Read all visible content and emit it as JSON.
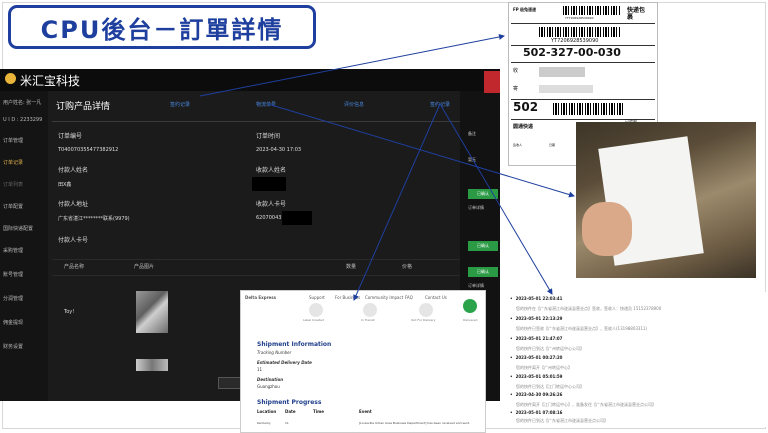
{
  "slide_title": "CPU後台－訂單詳情",
  "app": {
    "name": "米汇宝科技",
    "sidebar": [
      "用户姓名:   张一凡",
      "U I D :   2233299",
      "订单管理",
      "订单记录",
      "订单列表",
      "订单配置",
      "国际快递配置",
      "采购管理",
      "账号管理",
      "分润管理",
      "佣金提现",
      "财务设置"
    ],
    "section_title": "订购产品详情",
    "tabs": [
      "签约记录",
      "物流单号",
      "评价信息",
      "签约记录"
    ],
    "fields": {
      "order_no_label": "订单编号",
      "order_no": "T040070355477382912",
      "order_time_label": "订单时间",
      "order_time": "2023-04-30 17:03",
      "payer_name_label": "付款人姓名",
      "payer_name": "田X鑫",
      "receiver_name_label": "收款人姓名",
      "payer_address_label": "付款人地址",
      "payer_address": "广东省湛江********联系(9979)",
      "receiver_card_label": "收款人卡号",
      "receiver_card": "62070043",
      "payer_card_label": "付款人卡号"
    },
    "table_headers": [
      "产品名称",
      "产品图片",
      "数量",
      "价格"
    ],
    "product_name": "Toy!",
    "right_col": [
      "备注",
      "暂无",
      "已确认",
      "订单详情",
      "已确认",
      "已确认",
      "订单详情",
      "订单详情"
    ]
  },
  "shipping_label": {
    "brand": "FP 极兔速递",
    "tracking_top": "YT7206928539090",
    "service": "快递包裹",
    "tracking_mid": "YT7206928539090",
    "route_code": "502-327-00-030",
    "sender_prefix": "收",
    "receiver_prefix": "寄",
    "zip": "502",
    "footer_label": "圆通快递",
    "sign": "签收人",
    "date_label": "日期",
    "footer_note": "已验视"
  },
  "tracking_site": {
    "nav": [
      "Delta Express",
      "Support",
      "For Business",
      "Community Impact",
      "FAQ",
      "Contact Us"
    ],
    "steps": [
      "Label Created",
      "In Transit",
      "Out For Delivery",
      "Delivered"
    ],
    "shipment_info_title": "Shipment Information",
    "tracking_number_label": "Tracking Number",
    "delivery_date_label": "Estimated Delivery Date",
    "delivery_date": "11",
    "destination_label": "Destination",
    "destination": "Guangzhou",
    "progress_title": "Shipment Progress",
    "columns": [
      "Location",
      "Date",
      "Time",
      "Event"
    ],
    "row": [
      "Kentucky",
      "11",
      "",
      "[Louisville Urban Area Business Department] has been received and sent."
    ]
  },
  "log": [
    {
      "date": "2023-05-01 22:03:41",
      "text": "您的快件在【广东省湛江市遂溪县营业点】签收，签收人：快递员 15152378900"
    },
    {
      "date": "2023-05-01 22:13:29",
      "text": "您的快件已签收【广东省湛江市遂溪县营业点】，签收人(13198803311)"
    },
    {
      "date": "2023-05-01 21:47:07",
      "text": "您的快件已到达【广州转运中心公司】"
    },
    {
      "date": "2023-05-01 00:27:20",
      "text": "您的快件离开【广州转运中心】"
    },
    {
      "date": "2023-05-01 05:01:59",
      "text": "您的快件已到达【江门转运中心公司】"
    },
    {
      "date": "2023-04-30 09:26:26",
      "text": "您的快件离开【江门转运中心】，准备发往【广东省湛江市遂溪县营业点公司】"
    },
    {
      "date": "2023-05-01 07:08:16",
      "text": "您的快件已到达【广东省湛江市遂溪县营业点公司】"
    }
  ]
}
